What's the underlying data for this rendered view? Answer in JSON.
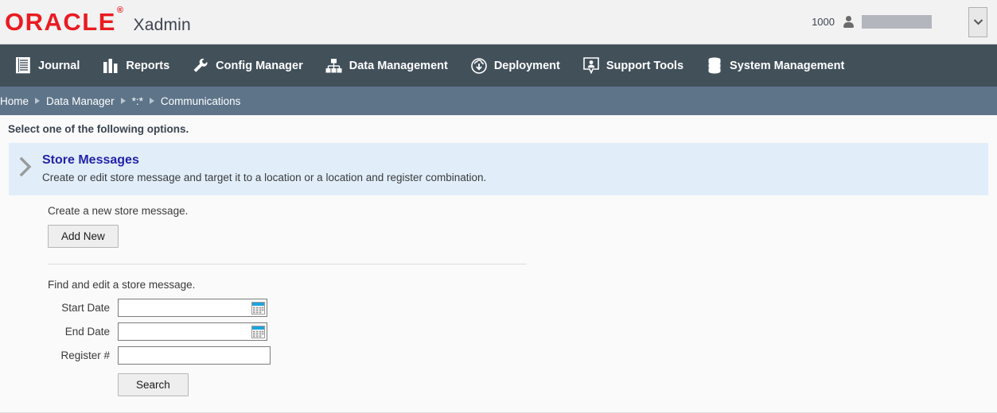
{
  "header": {
    "logo_text": "ORACLE",
    "logo_registered": "®",
    "app_name": "Xadmin",
    "store_number": "1000",
    "user_icon": "user-icon",
    "dropdown_icon": "chevron-down-icon",
    "brand_color": "#ea1b22"
  },
  "nav": {
    "background": "#42505a",
    "items": [
      {
        "label": "Journal",
        "icon": "journal-icon"
      },
      {
        "label": "Reports",
        "icon": "bar-chart-icon"
      },
      {
        "label": "Config Manager",
        "icon": "wrench-icon"
      },
      {
        "label": "Data Management",
        "icon": "hierarchy-icon"
      },
      {
        "label": "Deployment",
        "icon": "cloud-download-icon"
      },
      {
        "label": "Support Tools",
        "icon": "support-person-icon"
      },
      {
        "label": "System Management",
        "icon": "database-icon"
      }
    ]
  },
  "breadcrumb": {
    "background": "#5d7489",
    "items": [
      "Home",
      "Data Manager",
      "*:*",
      "Communications"
    ]
  },
  "main": {
    "instruction": "Select one of the following options.",
    "option": {
      "title": "Store Messages",
      "description": "Create or edit store message and target it to a location or a location and register combination.",
      "chevron_icon": "chevron-right-icon",
      "background": "#e1eefa",
      "title_color": "#2323a8"
    },
    "create_section": {
      "text": "Create a new store message.",
      "add_button": "Add New"
    },
    "find_section": {
      "text": "Find and edit a store message.",
      "fields": [
        {
          "label": "Start Date",
          "value": "",
          "placeholder": "",
          "icon": "calendar-icon"
        },
        {
          "label": "End Date",
          "value": "",
          "placeholder": "",
          "icon": "calendar-icon"
        },
        {
          "label": "Register #",
          "value": "",
          "placeholder": "",
          "icon": ""
        }
      ],
      "search_button": "Search"
    }
  }
}
